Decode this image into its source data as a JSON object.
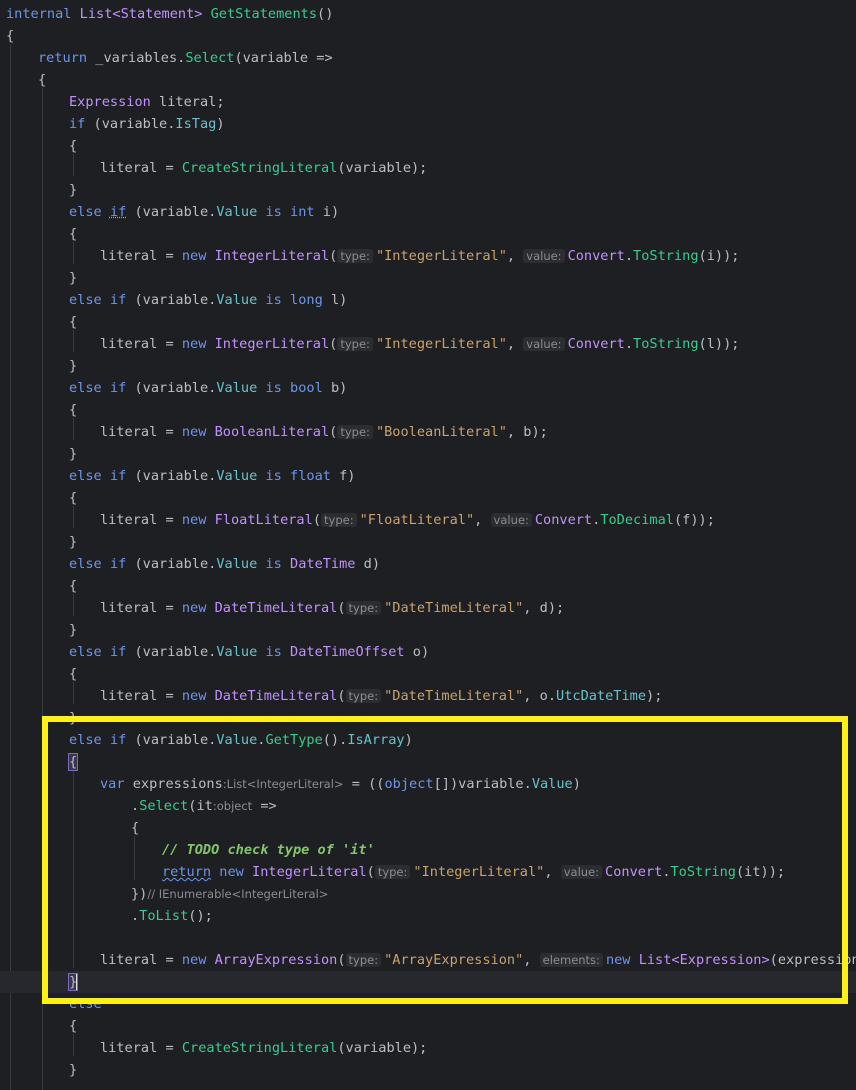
{
  "code": {
    "l01": {
      "kw": "internal",
      "type": "List<Statement>",
      "fn": "GetStatements",
      "rest": "()"
    },
    "l02": "{",
    "l03": {
      "kw": "return",
      "field": "_variables",
      "dot": ".",
      "fn": "Select",
      "rest": "(variable =>"
    },
    "l04": "{",
    "l05": {
      "type": "Expression",
      "rest": " literal;"
    },
    "l06": {
      "kw": "if",
      "rest1": " (variable.",
      "prop": "IsTag",
      "rest2": ")"
    },
    "l07": "{",
    "l08": {
      "text1": "literal = ",
      "fn": "CreateStringLiteral",
      "rest": "(variable);"
    },
    "l09": "}",
    "l10": {
      "kw1": "else",
      "kw2": "if",
      "rest1": " (variable.",
      "prop": "Value",
      "kw3": "is",
      "kw4": "int",
      "rest2": " i)"
    },
    "l11": "{",
    "l12": {
      "text1": "literal = ",
      "kw": "new",
      "type": "IntegerLiteral",
      "hint1": "type:",
      "str1": "\"IntegerLiteral\"",
      "hint2": "value:",
      "cls": "Convert",
      "fn": "ToString",
      "rest": "(i));"
    },
    "l13": "}",
    "l14": {
      "kw1": "else",
      "kw2": "if",
      "rest1": " (variable.",
      "prop": "Value",
      "kw3": "is",
      "kw4": "long",
      "rest2": " l)"
    },
    "l15": "{",
    "l16": {
      "text1": "literal = ",
      "kw": "new",
      "type": "IntegerLiteral",
      "hint1": "type:",
      "str1": "\"IntegerLiteral\"",
      "hint2": "value:",
      "cls": "Convert",
      "fn": "ToString",
      "rest": "(l));"
    },
    "l17": "}",
    "l18": {
      "kw1": "else",
      "kw2": "if",
      "rest1": " (variable.",
      "prop": "Value",
      "kw3": "is",
      "kw4": "bool",
      "rest2": " b)"
    },
    "l19": "{",
    "l20": {
      "text1": "literal = ",
      "kw": "new",
      "type": "BooleanLiteral",
      "hint1": "type:",
      "str1": "\"BooleanLiteral\"",
      "rest": ", b);"
    },
    "l21": "}",
    "l22": {
      "kw1": "else",
      "kw2": "if",
      "rest1": " (variable.",
      "prop": "Value",
      "kw3": "is",
      "kw4": "float",
      "rest2": " f)"
    },
    "l23": "{",
    "l24": {
      "text1": "literal = ",
      "kw": "new",
      "type": "FloatLiteral",
      "hint1": "type:",
      "str1": "\"FloatLiteral\"",
      "hint2": "value:",
      "cls": "Convert",
      "fn": "ToDecimal",
      "rest": "(f));"
    },
    "l25": "}",
    "l26": {
      "kw1": "else",
      "kw2": "if",
      "rest1": " (variable.",
      "prop": "Value",
      "kw3": "is",
      "type": "DateTime",
      "rest2": " d)"
    },
    "l27": "{",
    "l28": {
      "text1": "literal = ",
      "kw": "new",
      "type": "DateTimeLiteral",
      "hint1": "type:",
      "str1": "\"DateTimeLiteral\"",
      "rest": ", d);"
    },
    "l29": "}",
    "l30": {
      "kw1": "else",
      "kw2": "if",
      "rest1": " (variable.",
      "prop": "Value",
      "kw3": "is",
      "type": "DateTimeOffset",
      "rest2": " o)"
    },
    "l31": "{",
    "l32": {
      "text1": "literal = ",
      "kw": "new",
      "type": "DateTimeLiteral",
      "hint1": "type:",
      "str1": "\"DateTimeLiteral\"",
      "rest1": ", o.",
      "prop": "UtcDateTime",
      "rest2": ");"
    },
    "l33": "}",
    "l34": {
      "kw1": "else",
      "kw2": "if",
      "rest1": " (variable.",
      "prop1": "Value",
      "dot": ".",
      "fn": "GetType",
      "rest2": "().",
      "prop2": "IsArray",
      "rest3": ")"
    },
    "l35": "{",
    "l36": {
      "kw": "var",
      "var": " expressions",
      "hint": ":List<IntegerLiteral>",
      "rest1": " = ((",
      "kw2": "object",
      "rest2": "[])variable.",
      "prop": "Value",
      "rest3": ")"
    },
    "l37": {
      "dot": ".",
      "fn": "Select",
      "rest1": "(it",
      "hint": ":object",
      "rest2": " =>"
    },
    "l38": "{",
    "l39": "// TODO check type of 'it'",
    "l40": {
      "kw1": "return",
      "kw2": "new",
      "type": "IntegerLiteral",
      "hint1": "type:",
      "str1": "\"IntegerLiteral\"",
      "hint2": "value:",
      "cls": "Convert",
      "fn": "ToString",
      "rest": "(it));"
    },
    "l41": {
      "rest": "})",
      "hint": "// IEnumerable<IntegerLiteral>"
    },
    "l42": {
      "dot": ".",
      "fn": "ToList",
      "rest": "();"
    },
    "l44": {
      "text1": "literal = ",
      "kw": "new",
      "type": "ArrayExpression",
      "hint1": "type:",
      "str1": "\"ArrayExpression\"",
      "hint2": "elements:",
      "kw2": "new",
      "type2": "List<Expression>",
      "rest": "(expressions));"
    },
    "l45": "}",
    "l46": "else",
    "l47": "{",
    "l48": {
      "text1": "literal = ",
      "fn": "CreateStringLiteral",
      "rest": "(variable);"
    },
    "l49": "}"
  },
  "colors": {
    "background": "#1e1f22",
    "keyword": "#6c95eb",
    "type": "#c191ff",
    "method": "#39cc8f",
    "property": "#66c3cc",
    "string": "#c9a26d",
    "comment": "#85c46c",
    "highlight_box": "#fff018"
  }
}
